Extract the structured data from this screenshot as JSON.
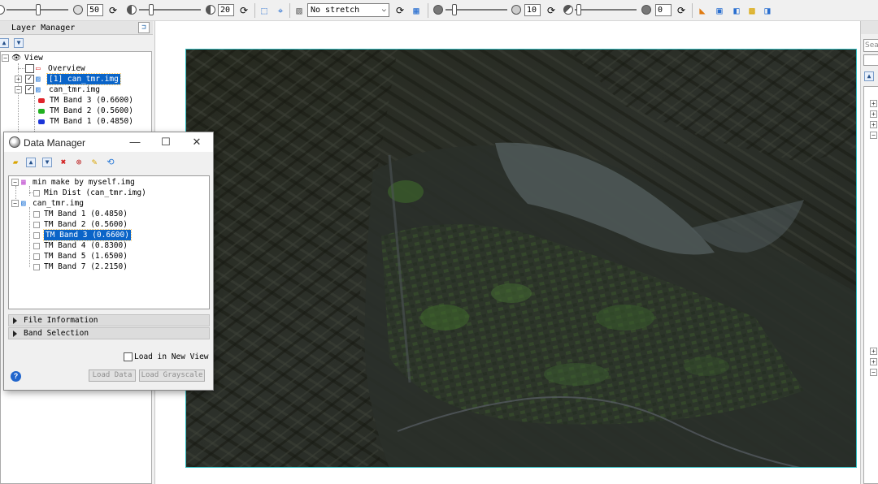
{
  "toolbar": {
    "brightness_value": "50",
    "contrast_value": "20",
    "stretch_select": "No stretch",
    "sharpen_value": "10",
    "transparency_value": "0"
  },
  "layer_manager": {
    "title": "Layer Manager",
    "tree": {
      "view": "View",
      "overview": "Overview",
      "layer_selected": "[1] can_tmr.img",
      "raster": "can_tmr.img",
      "bands": [
        {
          "label": "TM Band 3 (0.6600)",
          "color": "#e0252b"
        },
        {
          "label": "TM Band 2 (0.5600)",
          "color": "#20b020"
        },
        {
          "label": "TM Band 1 (0.4850)",
          "color": "#1b35d8"
        }
      ]
    }
  },
  "data_manager": {
    "title": "Data Manager",
    "tree": {
      "file1": "min make by myself.img",
      "file1_children": [
        "Min Dist (can_tmr.img)"
      ],
      "file2": "can_tmr.img",
      "file2_bands": [
        "TM Band 1 (0.4850)",
        "TM Band 2 (0.5600)",
        "TM Band 3 (0.6600)",
        "TM Band 4 (0.8300)",
        "TM Band 5 (1.6500)",
        "TM Band 7 (2.2150)"
      ],
      "selected_index": 2
    },
    "sections": {
      "file_information": "File Information",
      "band_selection": "Band Selection"
    },
    "load_in_new_view": "Load in New View",
    "load_in_new_view_checked": false,
    "buttons": {
      "load_data": "Load Data",
      "load_grayscale": "Load Grayscale"
    }
  },
  "right_panel": {
    "search_placeholder": "Sea"
  },
  "colors": {
    "selection": "#0a64c8",
    "image_border": "#2fbfc4"
  }
}
